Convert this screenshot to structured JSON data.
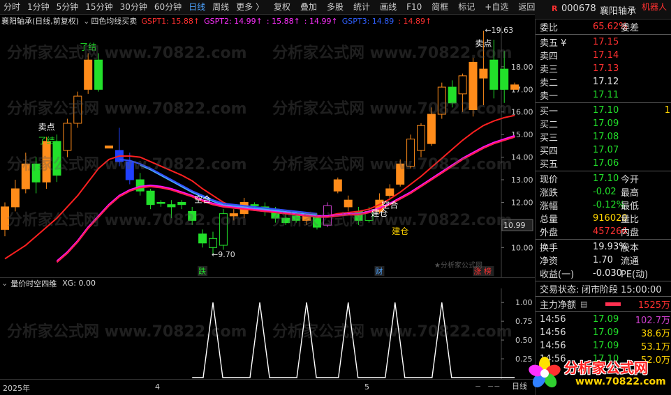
{
  "toolbar": {
    "left": [
      "分时",
      "1分钟",
      "5分钟",
      "15分钟",
      "30分钟",
      "60分钟",
      "日线",
      "周线",
      "更多 〉"
    ],
    "active": "日线",
    "right": [
      "复权",
      "叠加",
      "多股",
      "统计",
      "画线",
      "F10",
      "简框",
      "标记",
      "+自选",
      "返回"
    ]
  },
  "stock": {
    "prefix": "R",
    "code": "000678",
    "name": "襄阳轴承",
    "robot": "机器人"
  },
  "infobar": {
    "title": "襄阳轴承(日线,前复权)",
    "indicator": "四色均线买卖",
    "gspt1": "GSPT1: 15.88↑",
    "gspt2": "GSPT2: 14.99↑",
    "gspt2b": ": 15.88↑",
    "gspt2c": ": 14.99↑",
    "gspt3": "GSPT3: 14.89",
    "gspt3b": ": 14.89↑"
  },
  "chart_data": {
    "type": "candlestick",
    "ylim": [
      9.3,
      19.6
    ],
    "yticks": [
      "18.00",
      "17.00",
      "16.00",
      "15.00",
      "14.00",
      "13.00",
      "12.00",
      "11.00",
      "10.00"
    ],
    "current_price_label": "10.99",
    "high_label": "19.63",
    "low_label": "9.70",
    "candles": [
      {
        "o": 10.8,
        "c": 11.8,
        "h": 12.0,
        "l": 10.5
      },
      {
        "o": 11.8,
        "c": 12.6,
        "h": 13.0,
        "l": 11.6
      },
      {
        "o": 12.6,
        "c": 13.7,
        "h": 14.2,
        "l": 12.4
      },
      {
        "o": 13.7,
        "c": 12.9,
        "h": 14.0,
        "l": 12.4
      },
      {
        "o": 12.9,
        "c": 14.7,
        "h": 14.9,
        "l": 12.6
      },
      {
        "o": 14.7,
        "c": 13.2,
        "h": 15.0,
        "l": 12.9
      },
      {
        "o": 14.3,
        "c": 15.5,
        "h": 15.7,
        "l": 14.0
      },
      {
        "o": 15.5,
        "c": 16.7,
        "h": 16.9,
        "l": 15.3
      },
      {
        "o": 17.0,
        "c": 18.3,
        "h": 18.6,
        "l": 16.8
      },
      {
        "o": 18.3,
        "c": 17.0,
        "h": 18.6,
        "l": 16.9
      },
      {
        "o": 14.5,
        "c": 14.4,
        "h": 14.5,
        "l": 14.4
      },
      {
        "o": 14.3,
        "c": 13.8,
        "h": 15.3,
        "l": 13.6
      },
      {
        "o": 13.8,
        "c": 13.0,
        "h": 14.2,
        "l": 12.8
      },
      {
        "o": 13.0,
        "c": 12.5,
        "h": 13.3,
        "l": 12.3
      },
      {
        "o": 12.5,
        "c": 11.9,
        "h": 12.6,
        "l": 11.7
      },
      {
        "o": 12.0,
        "c": 11.95,
        "h": 12.1,
        "l": 11.8
      },
      {
        "o": 11.9,
        "c": 11.8,
        "h": 12.1,
        "l": 11.3
      },
      {
        "o": 12.0,
        "c": 11.9,
        "h": 12.1,
        "l": 11.7
      },
      {
        "o": 11.6,
        "c": 11.2,
        "h": 11.8,
        "l": 11.0
      },
      {
        "o": 10.6,
        "c": 10.2,
        "h": 10.8,
        "l": 10.0
      },
      {
        "o": 10.0,
        "c": 10.4,
        "h": 10.7,
        "l": 9.7
      },
      {
        "o": 10.1,
        "c": 11.5,
        "h": 11.7,
        "l": 9.9
      },
      {
        "o": 11.4,
        "c": 11.5,
        "h": 11.7,
        "l": 11.2
      },
      {
        "o": 11.5,
        "c": 12.0,
        "h": 12.2,
        "l": 11.3
      },
      {
        "o": 11.9,
        "c": 11.85,
        "h": 12.0,
        "l": 11.7
      },
      {
        "o": 11.8,
        "c": 11.6,
        "h": 12.0,
        "l": 11.4
      },
      {
        "o": 11.7,
        "c": 11.3,
        "h": 11.8,
        "l": 11.1
      },
      {
        "o": 11.3,
        "c": 11.1,
        "h": 11.5,
        "l": 11.0
      },
      {
        "o": 11.4,
        "c": 11.2,
        "h": 11.6,
        "l": 11.1
      },
      {
        "o": 11.2,
        "c": 11.4,
        "h": 11.5,
        "l": 11.0
      },
      {
        "o": 11.4,
        "c": 10.9,
        "h": 11.5,
        "l": 10.8
      },
      {
        "o": 10.99,
        "c": 11.85,
        "h": 12.0,
        "l": 10.9
      },
      {
        "o": 12.5,
        "c": 13.0,
        "h": 13.1,
        "l": 12.4
      },
      {
        "o": 11.8,
        "c": 12.1,
        "h": 12.3,
        "l": 11.6
      },
      {
        "o": 11.6,
        "c": 11.2,
        "h": 11.8,
        "l": 11.0
      },
      {
        "o": 11.2,
        "c": 11.6,
        "h": 11.8,
        "l": 11.1
      },
      {
        "o": 11.6,
        "c": 12.1,
        "h": 12.4,
        "l": 11.5
      },
      {
        "o": 12.3,
        "c": 12.6,
        "h": 12.8,
        "l": 12.1
      },
      {
        "o": 12.8,
        "c": 13.7,
        "h": 13.9,
        "l": 12.7
      },
      {
        "o": 13.6,
        "c": 14.8,
        "h": 15.0,
        "l": 13.5
      },
      {
        "o": 14.3,
        "c": 15.4,
        "h": 15.5,
        "l": 14.0
      },
      {
        "o": 14.6,
        "c": 15.9,
        "h": 16.2,
        "l": 14.5
      },
      {
        "o": 15.9,
        "c": 17.1,
        "h": 17.3,
        "l": 15.7
      },
      {
        "o": 17.1,
        "c": 16.4,
        "h": 17.4,
        "l": 16.2
      },
      {
        "o": 16.8,
        "c": 17.6,
        "h": 17.7,
        "l": 16.0
      },
      {
        "o": 16.1,
        "c": 18.2,
        "h": 18.4,
        "l": 15.8
      },
      {
        "o": 17.5,
        "c": 17.9,
        "h": 19.6,
        "l": 16.3
      },
      {
        "o": 18.3,
        "c": 17.0,
        "h": 19.2,
        "l": 16.6
      },
      {
        "o": 17.9,
        "c": 17.0,
        "h": 18.7,
        "l": 16.4
      },
      {
        "o": 17.0,
        "c": 17.2,
        "h": 17.3,
        "l": 17.0
      }
    ],
    "ma_series": [
      {
        "color": "#ff2020",
        "values": [
          9.5,
          9.8,
          10.1,
          10.5,
          10.9,
          11.3,
          11.8,
          12.3,
          12.9,
          13.5,
          13.9,
          14.05,
          14.05,
          14.0,
          13.8,
          13.6,
          13.4,
          13.2,
          12.95,
          12.6,
          12.3,
          12.0,
          11.8,
          11.7,
          11.65,
          11.6,
          11.55,
          11.5,
          11.45,
          11.4,
          11.35,
          11.4,
          11.5,
          11.55,
          11.6,
          11.7,
          11.9,
          12.15,
          12.45,
          12.8,
          13.15,
          13.55,
          13.95,
          14.35,
          14.75,
          15.1,
          15.4,
          15.6,
          15.75,
          15.85
        ]
      },
      {
        "color": "#ff10ff",
        "values": [
          null,
          null,
          null,
          null,
          null,
          9.4,
          9.8,
          10.3,
          10.9,
          11.4,
          11.9,
          12.3,
          12.55,
          12.7,
          12.75,
          12.7,
          12.6,
          12.45,
          12.3,
          12.1,
          11.95,
          11.85,
          11.8,
          11.75,
          11.7,
          11.65,
          11.6,
          11.55,
          11.5,
          11.45,
          11.4,
          11.4,
          11.45,
          11.5,
          11.5,
          11.6,
          11.75,
          11.95,
          12.2,
          12.45,
          12.75,
          13.05,
          13.35,
          13.65,
          13.95,
          14.2,
          14.45,
          14.65,
          14.8,
          14.95
        ]
      },
      {
        "color": "#ff2050",
        "values": [
          null,
          null,
          null,
          null,
          null,
          9.35,
          9.75,
          10.25,
          10.85,
          11.35,
          11.85,
          12.25,
          12.5,
          12.65,
          12.7,
          12.65,
          12.55,
          12.4,
          12.25,
          12.05,
          11.9,
          11.8,
          11.75,
          11.7,
          11.65,
          11.6,
          11.55,
          11.5,
          11.45,
          11.4,
          11.35,
          11.35,
          11.4,
          11.45,
          11.45,
          11.55,
          11.7,
          11.9,
          12.15,
          12.4,
          12.7,
          13.0,
          13.3,
          13.6,
          13.9,
          14.15,
          14.4,
          14.6,
          14.75,
          14.89
        ]
      },
      {
        "color": "#3050ff",
        "values": [
          null,
          null,
          null,
          null,
          null,
          null,
          null,
          null,
          null,
          null,
          null,
          13.9,
          13.85,
          13.7,
          13.5,
          13.25,
          13.0,
          12.75,
          12.5,
          12.3,
          12.1,
          11.95,
          11.9,
          11.85,
          11.8,
          11.75,
          11.7,
          11.65,
          11.6,
          11.55,
          11.5,
          null,
          null,
          null,
          null,
          null,
          null,
          null,
          null,
          null,
          null,
          null,
          null,
          null,
          null,
          null,
          null,
          null,
          null,
          null
        ]
      }
    ],
    "labels": [
      {
        "text": "了结",
        "i": 8,
        "y": 18.75,
        "color": "#22e02a"
      },
      {
        "text": "卖点",
        "i": 4,
        "y": 15.2,
        "color": "#ffffff"
      },
      {
        "text": "了结",
        "i": 4,
        "y": 14.6,
        "color": "#22e02a"
      },
      {
        "text": "空合",
        "i": 19,
        "y": 12.0,
        "color": "#ffffff"
      },
      {
        "text": "建仓",
        "i": 36,
        "y": 11.4,
        "color": "#ffffff"
      },
      {
        "text": "空合",
        "i": 37,
        "y": 11.75,
        "color": "#ffffff"
      },
      {
        "text": "建仓",
        "i": 38,
        "y": 10.6,
        "color": "#ffd400"
      },
      {
        "text": "卖点",
        "i": 46,
        "y": 18.9,
        "color": "#ffffff"
      }
    ],
    "bottom_labels": [
      {
        "text": "跌",
        "i": 19,
        "color": "#22e02a"
      },
      {
        "text": "财",
        "i": 36,
        "color": "#4da3ff"
      },
      {
        "text": "涨 榜",
        "i": 46,
        "color": "#ff3030"
      }
    ],
    "sub": {
      "title": "量价时空四维",
      "xg_label": "XG: 0.00",
      "ylim": [
        0,
        1.15
      ],
      "yticks": [
        "1.00",
        "0.75",
        "0.50",
        "0.25"
      ],
      "peaks_at": [
        22,
        31,
        40,
        48,
        57,
        66
      ]
    },
    "dates": [
      "2025年",
      "4",
      "5"
    ]
  },
  "panel": {
    "weibi": {
      "label": "委比",
      "value": "65.62%",
      "right": "委差"
    },
    "asks": [
      {
        "label": "卖五 ¥",
        "price": "17.15",
        "color": "#ff3030"
      },
      {
        "label": "卖四",
        "price": "17.14",
        "color": "#ff3030"
      },
      {
        "label": "卖三",
        "price": "17.13",
        "color": "#ff3030"
      },
      {
        "label": "卖二",
        "price": "17.12",
        "color": "#e8e8e8"
      },
      {
        "label": "卖一",
        "price": "17.11",
        "color": "#22e02a"
      }
    ],
    "bids": [
      {
        "label": "买一",
        "price": "17.10",
        "color": "#22e02a",
        "vol": "1"
      },
      {
        "label": "买二",
        "price": "17.09",
        "color": "#22e02a"
      },
      {
        "label": "买三",
        "price": "17.08",
        "color": "#22e02a"
      },
      {
        "label": "买四",
        "price": "17.07",
        "color": "#22e02a"
      },
      {
        "label": "买五",
        "price": "17.06",
        "color": "#22e02a"
      }
    ],
    "stats": [
      {
        "label": "现价",
        "value": "17.10",
        "color": "#22e02a",
        "right": "今开"
      },
      {
        "label": "涨跌",
        "value": "-0.02",
        "color": "#22e02a",
        "right": "最高"
      },
      {
        "label": "涨幅",
        "value": "-0.12%",
        "color": "#22e02a",
        "right": "最低"
      },
      {
        "label": "总量",
        "value": "916020",
        "color": "#ffd400",
        "right": "量比"
      },
      {
        "label": "外盘",
        "value": "457266",
        "color": "#ff3030",
        "right": "内盘"
      }
    ],
    "stats2": [
      {
        "label": "换手",
        "value": "19.93%",
        "color": "#e8e8e8",
        "right": "股本"
      },
      {
        "label": "净资",
        "value": "1.70",
        "color": "#e8e8e8",
        "right": "流通"
      },
      {
        "label": "收益(一)",
        "value": "-0.030",
        "color": "#e8e8e8",
        "right": "PE(动)"
      }
    ],
    "status": {
      "label": "交易状态:",
      "value": "闭市阶段 15:00:00"
    },
    "netflow": {
      "label": "主力净额",
      "value": "1525万"
    },
    "ticks": [
      {
        "time": "14:56",
        "price": "17.09",
        "vol": "102.7万",
        "vcolor": "#d040d0"
      },
      {
        "time": "14:56",
        "price": "17.09",
        "vol": "38.6万",
        "vcolor": "#ffd400"
      },
      {
        "time": "14:56",
        "price": "17.09",
        "vol": "53.1万",
        "vcolor": "#ffd400"
      },
      {
        "time": "14:56",
        "price": "17.10",
        "vol": "52.0万",
        "vcolor": "#ffd400"
      }
    ],
    "bottom_tab": "日线"
  },
  "logo": {
    "line1": "分析家公式网",
    "line2": "www.70822.com"
  },
  "watermark": "分析家公式网 www.70822.com",
  "small_watermark": "★分析家公式网"
}
